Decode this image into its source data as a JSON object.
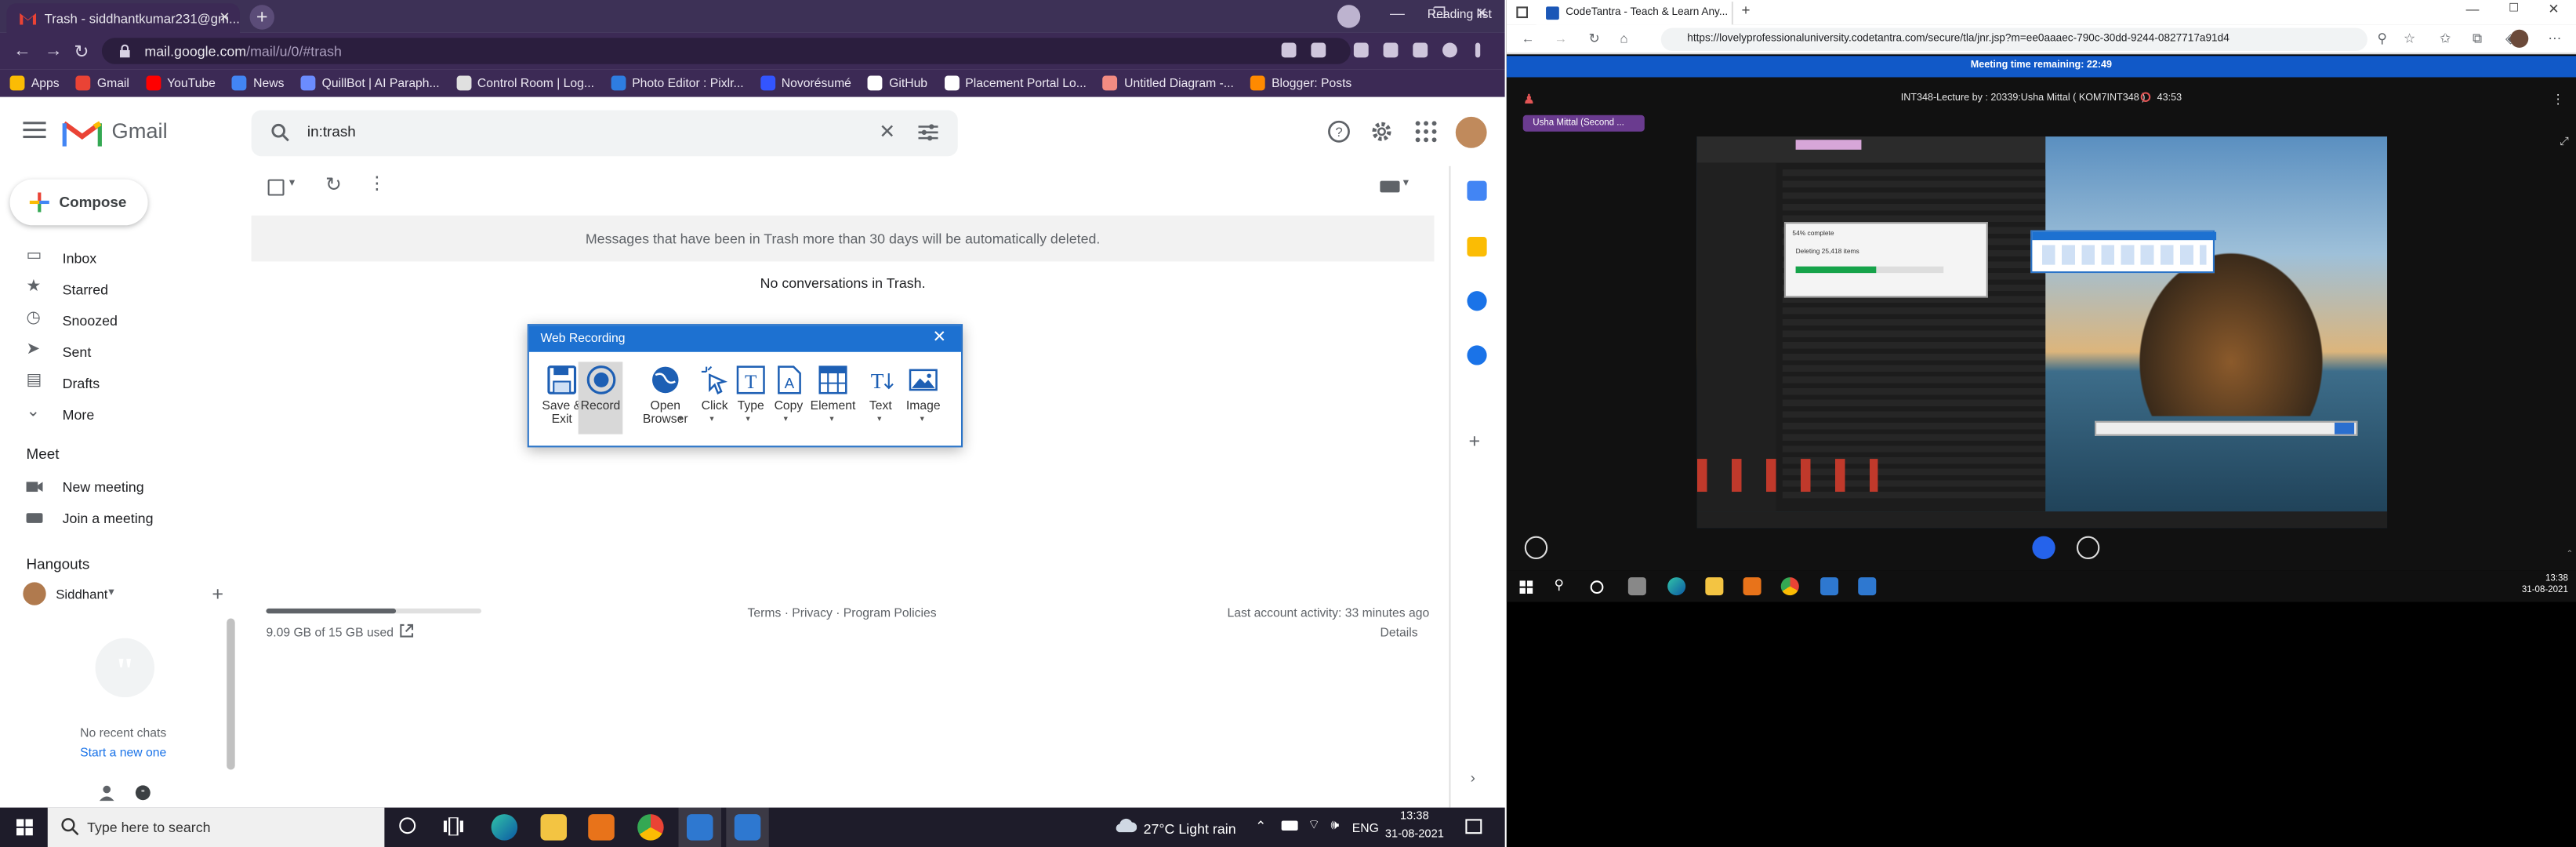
{
  "left_browser": {
    "tab_title": "Trash - siddhantkumar231@gm...",
    "url_host": "mail.google.com",
    "url_path": "/mail/u/0/#trash",
    "bookmarks": [
      "Apps",
      "Gmail",
      "YouTube",
      "News",
      "QuillBot | AI Paraph...",
      "Control Room | Log...",
      "Photo Editor : Pixlr...",
      "Novorésumé",
      "GitHub",
      "Placement Portal Lo...",
      "Untitled Diagram -...",
      "Blogger: Posts"
    ],
    "reading_list": "Reading list"
  },
  "gmail": {
    "product": "Gmail",
    "search_query": "in:trash",
    "compose": "Compose",
    "nav": [
      "Inbox",
      "Starred",
      "Snoozed",
      "Sent",
      "Drafts",
      "More"
    ],
    "meet_header": "Meet",
    "meet_items": [
      "New meeting",
      "Join a meeting"
    ],
    "hangouts_header": "Hangouts",
    "hangouts_user": "Siddhant",
    "no_chats": "No recent chats",
    "start_new": "Start a new one",
    "trash_notice": "Messages that have been in Trash more than 30 days will be automatically deleted.",
    "empty_msg": "No conversations in Trash.",
    "storage": "9.09 GB of 15 GB used",
    "storage_fraction": 0.606,
    "footer_links": "Terms · Privacy · Program Policies",
    "last_activity": "Last account activity: 33 minutes ago",
    "details": "Details"
  },
  "web_recording": {
    "title": "Web Recording",
    "buttons": [
      "Save & Exit",
      "Record",
      "Open Browser",
      "Click",
      "Type",
      "Copy",
      "Element",
      "Text",
      "Image"
    ]
  },
  "taskbar_left": {
    "search_placeholder": "Type here to search",
    "weather": "27°C  Light rain",
    "lang": "ENG",
    "time": "13:38",
    "date": "31-08-2021"
  },
  "right_browser": {
    "tab_title": "CodeTantra - Teach & Learn Any...",
    "url": "https://lovelyprofessionaluniversity.codetantra.com/secure/tla/jnr.jsp?m=ee0aaaec-790c-30dd-9244-0827717a91d4",
    "meeting_banner": "Meeting time remaining: 22:49",
    "lecture": "INT348-Lecture by : 20339:Usha Mittal ( KOM7INT348 )",
    "timer": "43:53",
    "participant": "Usha Mittal (Second ...",
    "inner_popup_title": "54% complete",
    "inner_popup_sub": "Deleting 25,418 items",
    "clock_time": "13:38",
    "clock_date": "31-08-2021"
  },
  "colors": {
    "chrome_purple": "#3c2a55",
    "gmail_red": "#ea4335",
    "blue": "#1a73e8",
    "meet_blue": "#1159c8"
  }
}
